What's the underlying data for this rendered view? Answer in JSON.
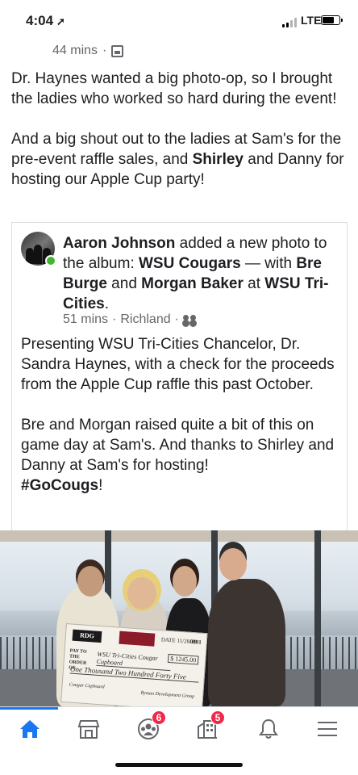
{
  "status_bar": {
    "time": "4:04",
    "carrier": "LTE",
    "battery_percent": 0.75,
    "signal_bars": 2,
    "signal_total": 4
  },
  "post": {
    "meta": {
      "time_ago": "44 mins",
      "separator": "·",
      "audience_icon": "album-icon"
    },
    "text_p1": "Dr. Haynes wanted a big photo-op, so I brought the ladies who worked so hard during the event!",
    "text_p2_a": "And a big shout out to the ladies at Sam's for the pre-event raffle sales, and ",
    "text_p2_bold1": "Shirley",
    "text_p2_b": " and Danny for hosting our Apple Cup party!"
  },
  "shared": {
    "author": "Aaron Johnson",
    "action_a": " added a new photo to the album: ",
    "album": "WSU Cougars",
    "action_b": " — with ",
    "tag1": "Bre Burge",
    "and": " and ",
    "tag2": "Morgan Baker",
    "at": " at ",
    "location_bold": "WSU Tri-Cities",
    "period": ".",
    "time_ago": "51 mins",
    "dot1": "·",
    "location": "Richland",
    "dot2": "·",
    "audience_icon": "friends-icon",
    "body_p1": "Presenting WSU Tri-Cities Chancelor, Dr. Sandra Haynes, with a check for the proceeds from the Apple Cup raffle this past October.",
    "body_p2": "Bre and Morgan raised quite a bit of this on game day at Sam's. And thanks to Shirley and Danny at Sam's for hosting!",
    "hashtag": "#GoCougs",
    "exclaim": "!"
  },
  "photo": {
    "check": {
      "logo": "RDG",
      "date": "DATE 11/28/19",
      "number": "0001",
      "pay_to": "PAY TO THE ORDER OF",
      "payee": "WSU Tri-Cities Cougar Cupboard",
      "amount": "$ 1245.00",
      "amount_words": "One Thousand Two Hundred Forty Five",
      "memo": "Cougar Cupboard",
      "signature": "Ryman Development Group"
    }
  },
  "tabbar": {
    "items": [
      {
        "name": "home",
        "icon": "home-icon",
        "active": true
      },
      {
        "name": "marketplace",
        "icon": "marketplace-icon"
      },
      {
        "name": "groups",
        "icon": "groups-icon",
        "badge": "6"
      },
      {
        "name": "pages",
        "icon": "pages-icon",
        "badge": "5"
      },
      {
        "name": "notifications",
        "icon": "bell-icon"
      },
      {
        "name": "menu",
        "icon": "menu-icon"
      }
    ]
  },
  "colors": {
    "brand": "#1877f2",
    "badge": "#f02849",
    "secondary_text": "#65676b",
    "online": "#42b72a"
  }
}
